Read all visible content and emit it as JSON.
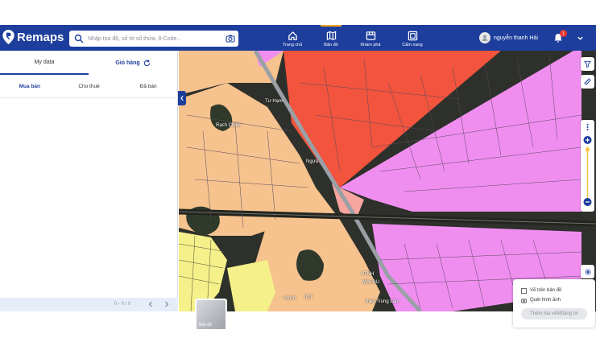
{
  "app": {
    "name": "Remaps"
  },
  "search": {
    "placeholder": "Nhập tọa độ, số tờ số thửa, 8-Code..."
  },
  "nav": [
    {
      "label": "Trang chủ",
      "icon": "home-icon"
    },
    {
      "label": "Bản đồ",
      "icon": "map-icon"
    },
    {
      "label": "Khám phá",
      "icon": "explore-icon"
    },
    {
      "label": "Cẩm nang",
      "icon": "handbook-icon"
    }
  ],
  "user": {
    "name": "nguyễn thanh Hải",
    "notifications": "1"
  },
  "sidebar": {
    "tabs": [
      {
        "label": "My data"
      },
      {
        "label": "Giỏ hàng"
      }
    ],
    "subtabs": [
      {
        "label": "Mua bán"
      },
      {
        "label": "Cho thuê"
      },
      {
        "label": "Đã bán"
      }
    ],
    "pager": {
      "count": "0 - 0 / 0"
    }
  },
  "map": {
    "labels": [
      "Rạch Chiếc",
      "Tư Hạnh",
      "Ngựa",
      "VTNH",
      "MẠI ĐU",
      "Vườn",
      "IOT",
      "thép Trung Lâm"
    ],
    "layer_thumbnail": "Bản đồ"
  },
  "popup": {
    "draw": "Vẽ trên bản đồ",
    "scan": "Quét hình ảnh",
    "post": "Thêm bài viết/Đăng tin"
  },
  "colors": {
    "brand": "#1d3e9c",
    "accent": "#f5a623",
    "residential": "#f6c28e",
    "commercial": "#f08ef0",
    "industrial": "#f2543d",
    "agri": "#f5f08a"
  }
}
